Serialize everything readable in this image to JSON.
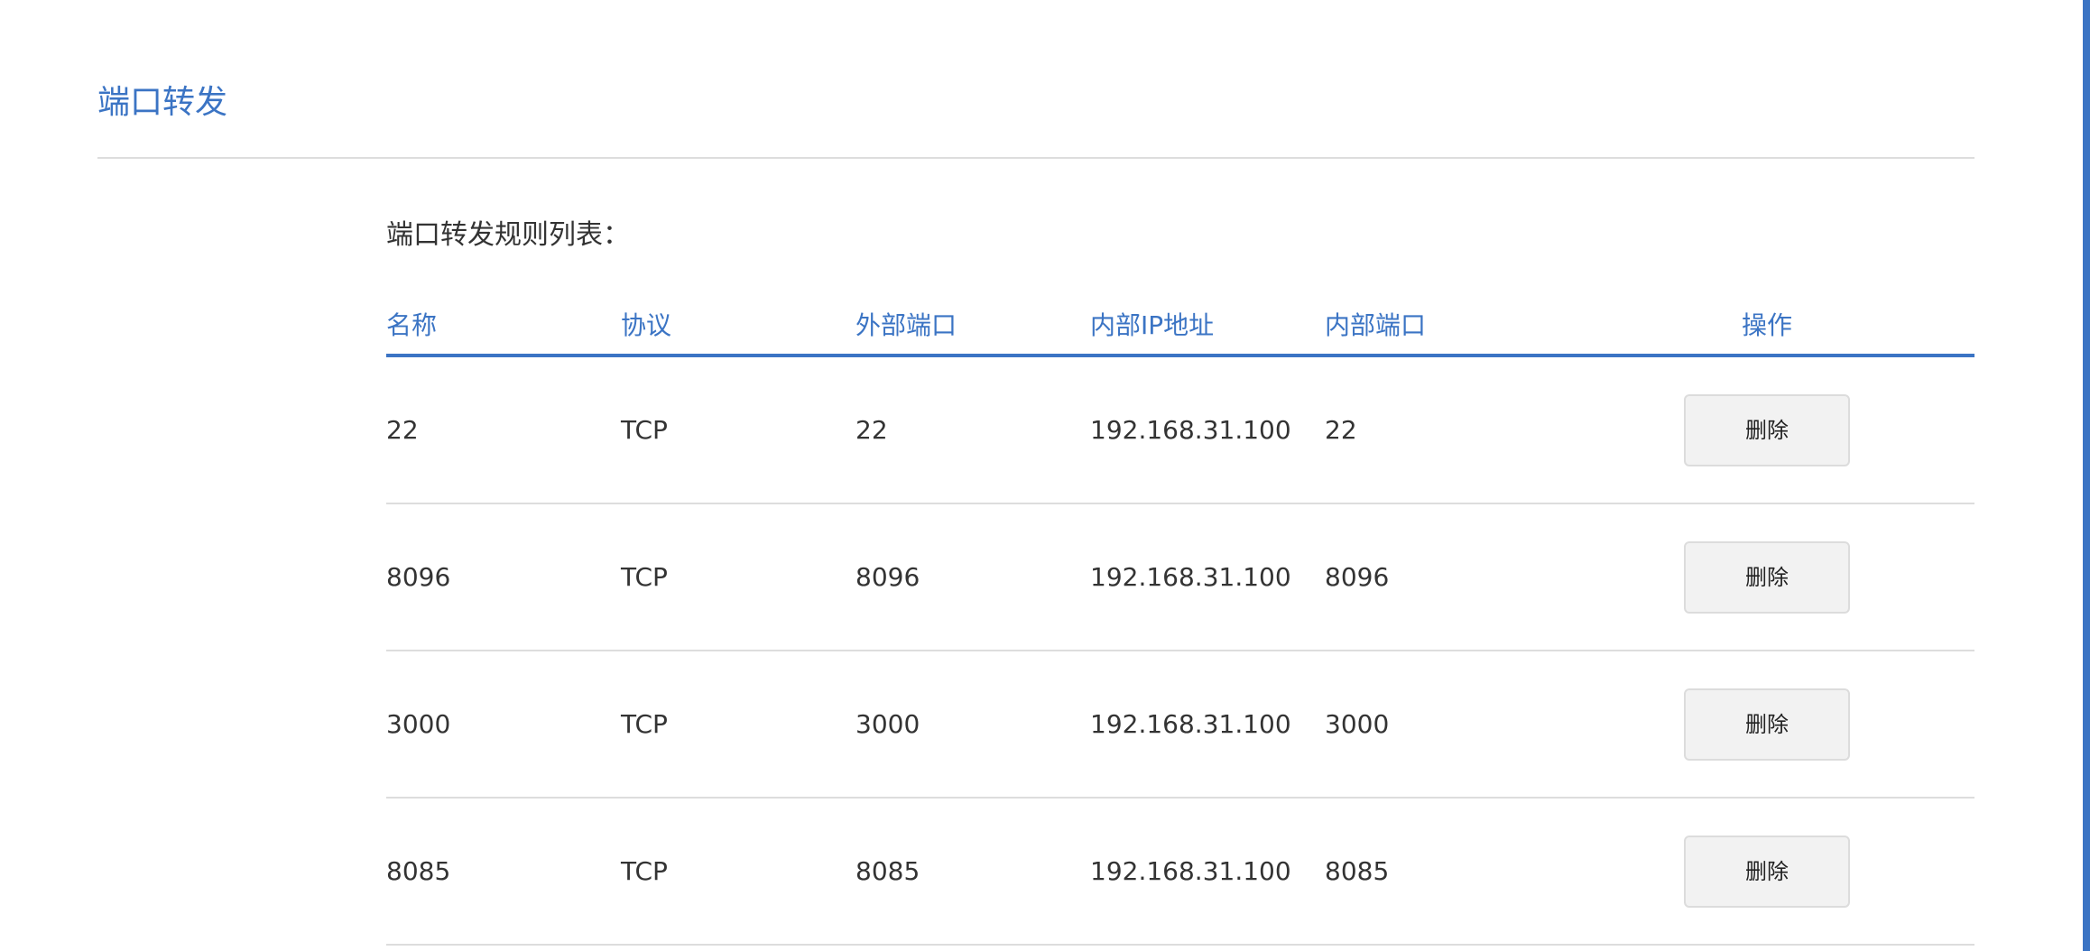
{
  "page": {
    "title": "端口转发",
    "accent_color": "#3b74c4"
  },
  "table": {
    "caption": "端口转发规则列表：",
    "headers": {
      "name": "名称",
      "protocol": "协议",
      "external_port": "外部端口",
      "internal_ip": "内部IP地址",
      "internal_port": "内部端口",
      "action": "操作"
    },
    "rows": [
      {
        "name": "22",
        "protocol": "TCP",
        "external_port": "22",
        "internal_ip": "192.168.31.100",
        "internal_port": "22",
        "action_label": "删除"
      },
      {
        "name": "8096",
        "protocol": "TCP",
        "external_port": "8096",
        "internal_ip": "192.168.31.100",
        "internal_port": "8096",
        "action_label": "删除"
      },
      {
        "name": "3000",
        "protocol": "TCP",
        "external_port": "3000",
        "internal_ip": "192.168.31.100",
        "internal_port": "3000",
        "action_label": "删除"
      },
      {
        "name": "8085",
        "protocol": "TCP",
        "external_port": "8085",
        "internal_ip": "192.168.31.100",
        "internal_port": "8085",
        "action_label": "删除"
      }
    ]
  }
}
